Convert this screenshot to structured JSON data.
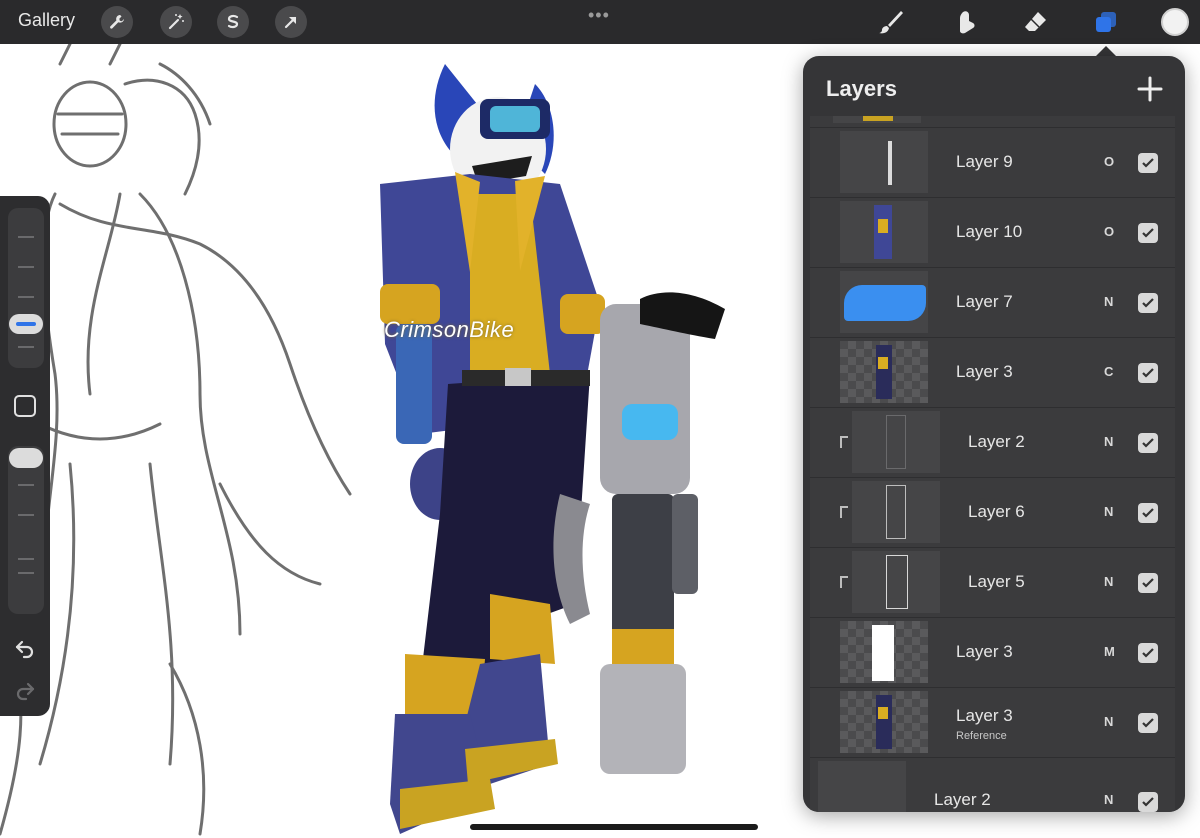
{
  "toolbar": {
    "gallery_label": "Gallery",
    "left_tools": [
      "wrench-icon",
      "magic-wand-icon",
      "selection-icon",
      "transform-arrow-icon"
    ],
    "right_tools": [
      "brush-icon",
      "smudge-icon",
      "eraser-icon",
      "layers-icon"
    ],
    "active_tool": "layers",
    "accent_color": "#2f74e8",
    "current_color": "#f2f2f2",
    "more_dots": "•••"
  },
  "canvas": {
    "watermark": "CrimsonBike"
  },
  "sidebar": {
    "brush_size_level": 0.62,
    "opacity_level": 1.0,
    "undo_icon": "undo-icon",
    "redo_icon": "redo-icon"
  },
  "layers_panel": {
    "title": "Layers",
    "add_icon": "plus-icon",
    "layers": [
      {
        "name": "Layer 9",
        "blend": "O",
        "visible": true,
        "clipped": false,
        "sub": ""
      },
      {
        "name": "Layer 10",
        "blend": "O",
        "visible": true,
        "clipped": false,
        "sub": ""
      },
      {
        "name": "Layer 7",
        "blend": "N",
        "visible": true,
        "clipped": false,
        "sub": ""
      },
      {
        "name": "Layer 3",
        "blend": "C",
        "visible": true,
        "clipped": false,
        "sub": ""
      },
      {
        "name": "Layer 2",
        "blend": "N",
        "visible": true,
        "clipped": true,
        "sub": ""
      },
      {
        "name": "Layer 6",
        "blend": "N",
        "visible": true,
        "clipped": true,
        "sub": ""
      },
      {
        "name": "Layer 5",
        "blend": "N",
        "visible": true,
        "clipped": true,
        "sub": ""
      },
      {
        "name": "Layer 3",
        "blend": "M",
        "visible": true,
        "clipped": false,
        "sub": ""
      },
      {
        "name": "Layer 3",
        "blend": "N",
        "visible": true,
        "clipped": false,
        "sub": "Reference"
      },
      {
        "name": "Layer 2",
        "blend": "N",
        "visible": true,
        "clipped": false,
        "sub": ""
      }
    ]
  }
}
